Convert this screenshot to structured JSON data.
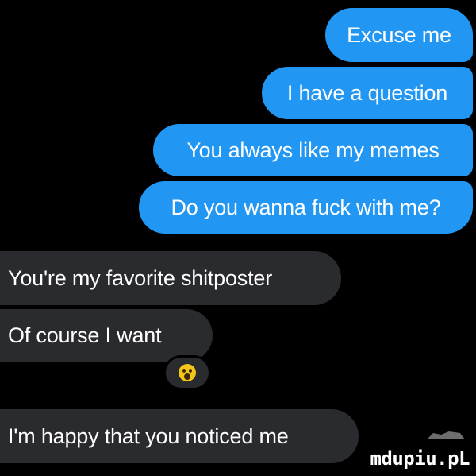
{
  "conversation": {
    "sent_messages": [
      "Excuse me",
      "I have a question",
      "You always like my memes",
      "Do you wanna fuck with me?"
    ],
    "received_messages": [
      "You're my favorite shitposter",
      "Of course I want",
      "I'm happy that you noticed me"
    ],
    "reaction": {
      "icon": "wow-face-icon",
      "color": "#f5c518"
    }
  },
  "colors": {
    "sent_bubble": "#2196f3",
    "received_bubble": "#2a2b2f",
    "background": "#000000"
  },
  "watermark": {
    "text": "mdupiu.pL"
  }
}
